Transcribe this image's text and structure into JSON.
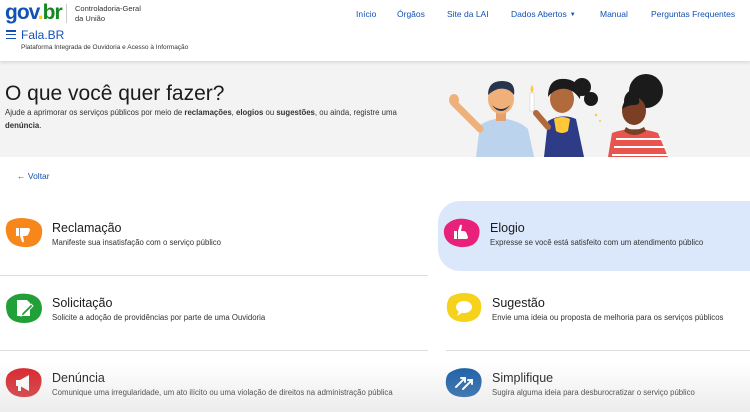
{
  "topbar": {
    "logo": {
      "part1": "gov",
      "dot": ".",
      "part2": "br"
    },
    "org_line1": "Controladoria-Geral",
    "org_line2": "da União",
    "nav": [
      {
        "label": "Início"
      },
      {
        "label": "Órgãos"
      },
      {
        "label": "Site da LAI"
      },
      {
        "label": "Dados Abertos"
      },
      {
        "label": "Manual"
      },
      {
        "label": "Perguntas Frequentes"
      }
    ]
  },
  "app": {
    "title": "Fala.BR",
    "subtitle": "Plataforma Integrada de Ouvidoria e Acesso à Informação"
  },
  "hero": {
    "title": "O que você quer fazer?",
    "desc_part1": "Ajude a aprimorar os serviços públicos por meio de ",
    "kw1": "reclamações",
    "sep1": ", ",
    "kw2": "elogios",
    "sep2": " ou ",
    "kw3": "sugestões",
    "desc_part2": ", ou ainda, registre uma ",
    "kw4": "denúncia",
    "desc_end": "."
  },
  "back": {
    "label": "Voltar",
    "arrow": "←"
  },
  "cards": [
    {
      "title": "Reclamação",
      "desc": "Manifeste sua insatisfação com o serviço público",
      "color": "#f7871b",
      "icon": "thumbs-down-icon"
    },
    {
      "title": "Elogio",
      "desc": "Expresse se você está satisfeito com um atendimento público",
      "color": "#e8217a",
      "icon": "thumbs-up-icon"
    },
    {
      "title": "Solicitação",
      "desc": "Solicite a adoção de providências por parte de uma Ouvidoria",
      "color": "#21a038",
      "icon": "document-pencil-icon"
    },
    {
      "title": "Sugestão",
      "desc": "Envie uma ideia ou proposta de melhoria para os serviços públicos",
      "color": "#f7d21c",
      "icon": "speech-bubble-icon"
    },
    {
      "title": "Denúncia",
      "desc": "Comunique uma irregularidade, um ato ilícito ou uma violação de direitos na administração pública",
      "color": "#d9252b",
      "icon": "megaphone-icon"
    },
    {
      "title": "Simplifique",
      "desc": "Sugira alguma ideia para desburocratizar o serviço público",
      "color": "#1a5fa8",
      "icon": "arrows-icon"
    }
  ]
}
